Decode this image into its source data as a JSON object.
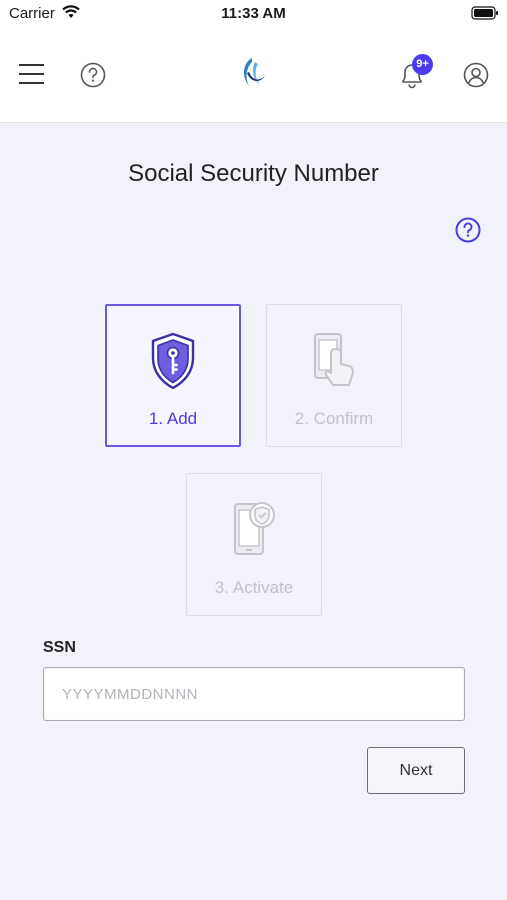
{
  "status_bar": {
    "carrier": "Carrier",
    "time": "11:33 AM"
  },
  "nav": {
    "notification_badge": "9+"
  },
  "page": {
    "title": "Social Security Number"
  },
  "steps": [
    {
      "label": "1. Add",
      "state": "active",
      "icon": "shield-key-icon"
    },
    {
      "label": "2. Confirm",
      "state": "disabled",
      "icon": "touch-phone-icon"
    },
    {
      "label": "3. Activate",
      "state": "disabled",
      "icon": "phone-shield-icon"
    }
  ],
  "form": {
    "ssn_label": "SSN",
    "ssn_placeholder": "YYYYMMDDNNNN",
    "ssn_value": "",
    "next_label": "Next"
  },
  "colors": {
    "accent": "#4a3de0",
    "background": "#f2f2fa",
    "disabled": "#c2c2c8"
  }
}
